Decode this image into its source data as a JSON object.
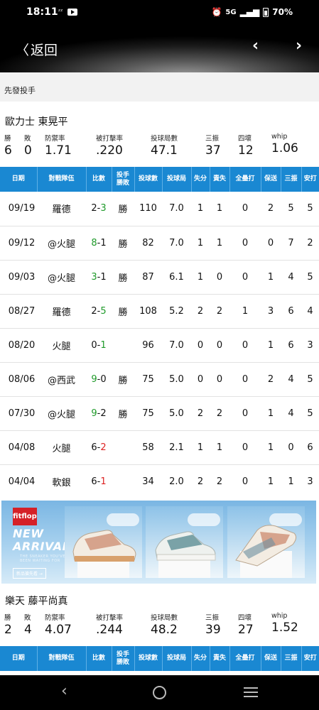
{
  "status_bar": {
    "time": "18:11",
    "small_icon": "ᶻᶻ",
    "network": "5G",
    "battery": "70%"
  },
  "header": {
    "back_label": "返回"
  },
  "section_title": "先發投手",
  "pitchers": [
    {
      "name": "歐力士 東晃平",
      "stats": [
        {
          "label": "勝",
          "value": "6"
        },
        {
          "label": "敗",
          "value": "0"
        },
        {
          "label": "防禦率",
          "value": "1.71"
        },
        {
          "label": "被打擊率",
          "value": ".220"
        },
        {
          "label": "投球局數",
          "value": "47.1"
        },
        {
          "label": "三振",
          "value": "37"
        },
        {
          "label": "四壞",
          "value": "12"
        },
        {
          "label": "whip",
          "value": "1.06"
        }
      ]
    },
    {
      "name": "樂天 藤平尚真",
      "stats": [
        {
          "label": "勝",
          "value": "2"
        },
        {
          "label": "敗",
          "value": "4"
        },
        {
          "label": "防禦率",
          "value": "4.07"
        },
        {
          "label": "被打擊率",
          "value": ".244"
        },
        {
          "label": "投球局數",
          "value": "48.2"
        },
        {
          "label": "三振",
          "value": "39"
        },
        {
          "label": "四壞",
          "value": "27"
        },
        {
          "label": "whip",
          "value": "1.52"
        }
      ]
    }
  ],
  "table": {
    "headers": [
      "日期",
      "對戰隊伍",
      "比數",
      "投手勝敗",
      "投球數",
      "投球局",
      "失分",
      "責失",
      "全壘打",
      "保送",
      "三振",
      "安打"
    ],
    "rows": [
      {
        "date": "09/19",
        "opp": "羅德",
        "s1": "2",
        "s2": "3",
        "win": "1",
        "dec": "勝",
        "np": "110",
        "ip": "7.0",
        "r": "1",
        "er": "1",
        "hr": "0",
        "bb": "2",
        "so": "5",
        "h": "5"
      },
      {
        "date": "09/12",
        "opp": "@火腿",
        "s1": "8",
        "s2": "1",
        "win": "0",
        "dec": "勝",
        "np": "82",
        "ip": "7.0",
        "r": "1",
        "er": "1",
        "hr": "0",
        "bb": "0",
        "so": "7",
        "h": "2"
      },
      {
        "date": "09/03",
        "opp": "@火腿",
        "s1": "3",
        "s2": "1",
        "win": "0",
        "dec": "勝",
        "np": "87",
        "ip": "6.1",
        "r": "1",
        "er": "0",
        "hr": "0",
        "bb": "1",
        "so": "4",
        "h": "5"
      },
      {
        "date": "08/27",
        "opp": "羅德",
        "s1": "2",
        "s2": "5",
        "win": "1",
        "dec": "勝",
        "np": "108",
        "ip": "5.2",
        "r": "2",
        "er": "2",
        "hr": "1",
        "bb": "3",
        "so": "6",
        "h": "4"
      },
      {
        "date": "08/20",
        "opp": "火腿",
        "s1": "0",
        "s2": "1",
        "win": "1",
        "dec": "",
        "np": "96",
        "ip": "7.0",
        "r": "0",
        "er": "0",
        "hr": "0",
        "bb": "1",
        "so": "6",
        "h": "3"
      },
      {
        "date": "08/06",
        "opp": "@西武",
        "s1": "9",
        "s2": "0",
        "win": "0",
        "dec": "勝",
        "np": "75",
        "ip": "5.0",
        "r": "0",
        "er": "0",
        "hr": "0",
        "bb": "2",
        "so": "4",
        "h": "5"
      },
      {
        "date": "07/30",
        "opp": "@火腿",
        "s1": "9",
        "s2": "2",
        "win": "0",
        "dec": "勝",
        "np": "75",
        "ip": "5.0",
        "r": "2",
        "er": "2",
        "hr": "0",
        "bb": "1",
        "so": "4",
        "h": "5"
      },
      {
        "date": "04/08",
        "opp": "火腿",
        "s1": "6",
        "s2": "2",
        "win": "-1",
        "dec": "",
        "np": "58",
        "ip": "2.1",
        "r": "1",
        "er": "1",
        "hr": "0",
        "bb": "1",
        "so": "0",
        "h": "6"
      },
      {
        "date": "04/04",
        "opp": "軟銀",
        "s1": "6",
        "s2": "1",
        "win": "-1",
        "dec": "",
        "np": "34",
        "ip": "2.0",
        "r": "2",
        "er": "2",
        "hr": "0",
        "bb": "1",
        "so": "1",
        "h": "3"
      }
    ]
  },
  "ad": {
    "brand": "fitflop",
    "title_line1": "NEW",
    "title_line2": "ARRIVALS",
    "subtitle": "THE SNEAKER YOU'VE BEEN WAITING FOR",
    "cta": "新品搶先看 →"
  },
  "colors": {
    "table_header": "#1a88d2",
    "win": "#1f9a2a",
    "loss": "#d22222"
  }
}
